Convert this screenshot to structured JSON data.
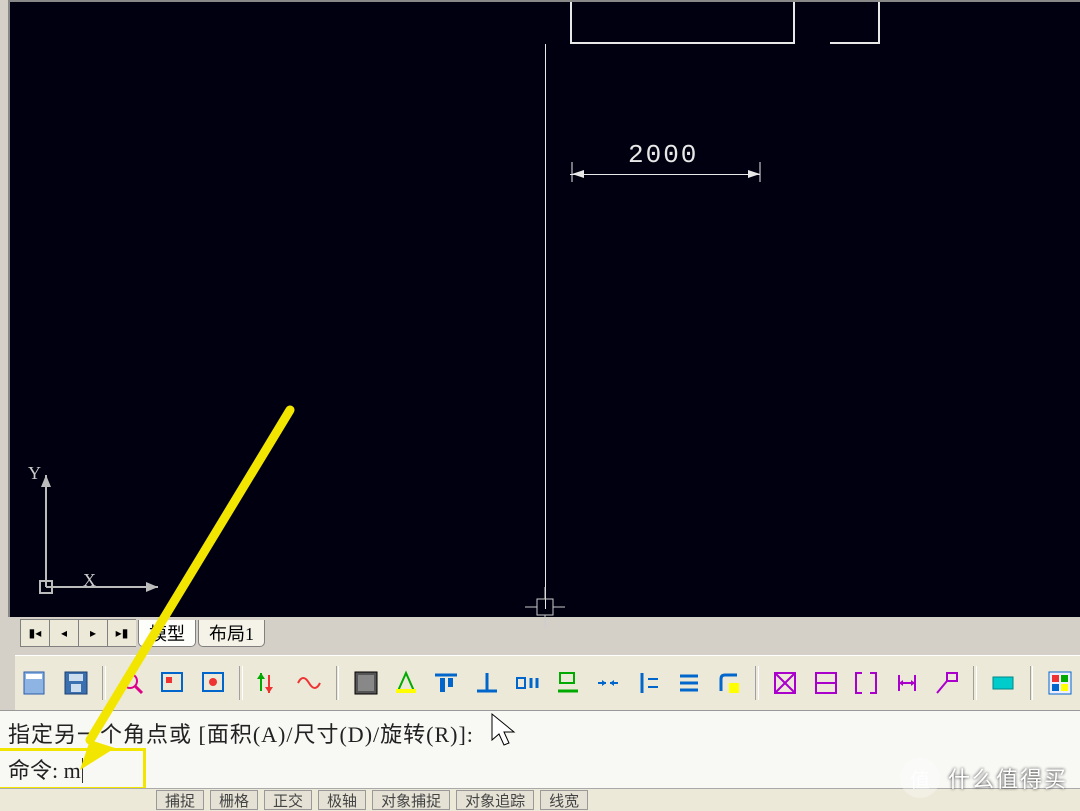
{
  "drawing": {
    "dim_horizontal": "2000"
  },
  "ucs": {
    "x": "X",
    "y": "Y"
  },
  "tabs": {
    "model": "模型",
    "layout1": "布局1"
  },
  "command": {
    "prompt_line": "指定另一个角点或 [面积(A)/尺寸(D)/旋转(R)]:",
    "input_label": "命令:",
    "input_value": "m"
  },
  "toolbar_icons": [
    "file-icon",
    "save-icon",
    "zoom-window-icon",
    "fit-icon",
    "pan-icon",
    "toggle-a-icon",
    "wave-icon",
    "layer-icon",
    "highlight-icon",
    "align-top-icon",
    "perp-icon",
    "gap-icon",
    "flag-icon",
    "tangent-icon",
    "offset-h-icon",
    "list-icon",
    "corner-icon",
    "box-x-icon",
    "box-h-icon",
    "bracket-icon",
    "dim-h-icon",
    "note-icon",
    "cyan-layer-icon",
    "props-icon"
  ],
  "status": {
    "items": [
      "捕捉",
      "栅格",
      "正交",
      "极轴",
      "对象捕捉",
      "对象追踪",
      "",
      "线宽",
      ""
    ]
  },
  "watermark": {
    "badge": "值",
    "text": "什么值得买"
  }
}
